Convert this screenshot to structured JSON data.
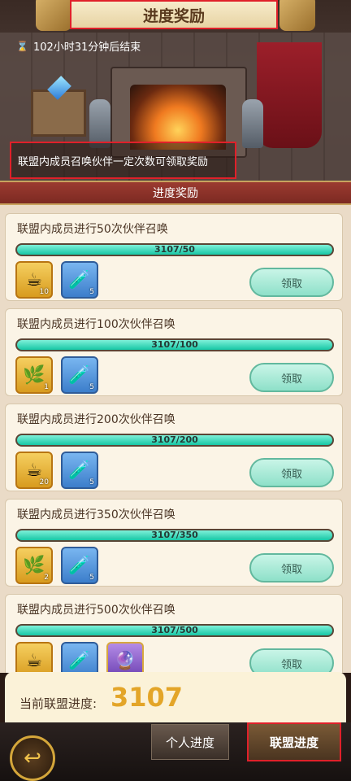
{
  "header": {
    "title": "进度奖励",
    "timer": "102小时31分钟后结束",
    "hint": "联盟内成员召唤伙伴一定次数可领取奖励"
  },
  "section": {
    "title": "进度奖励"
  },
  "tasks": [
    {
      "title": "联盟内成员进行50次伙伴召唤",
      "progress_text": "3107/50",
      "progress_fraction": 1.0,
      "rewards": [
        {
          "icon": "tea-cup-icon",
          "style": "gold",
          "count": "10"
        },
        {
          "icon": "potion-icon",
          "style": "blue",
          "count": "5"
        }
      ],
      "claim": "领取"
    },
    {
      "title": "联盟内成员进行100次伙伴召唤",
      "progress_text": "3107/100",
      "progress_fraction": 1.0,
      "rewards": [
        {
          "icon": "herb-bundle-icon",
          "style": "gold",
          "count": "1"
        },
        {
          "icon": "potion-icon",
          "style": "blue",
          "count": "5"
        }
      ],
      "claim": "领取"
    },
    {
      "title": "联盟内成员进行200次伙伴召唤",
      "progress_text": "3107/200",
      "progress_fraction": 1.0,
      "rewards": [
        {
          "icon": "tea-cup-icon",
          "style": "gold",
          "count": "20"
        },
        {
          "icon": "potion-icon",
          "style": "blue",
          "count": "5"
        }
      ],
      "claim": "领取"
    },
    {
      "title": "联盟内成员进行350次伙伴召唤",
      "progress_text": "3107/350",
      "progress_fraction": 1.0,
      "rewards": [
        {
          "icon": "herb-bundle-icon",
          "style": "gold",
          "count": "2"
        },
        {
          "icon": "potion-icon",
          "style": "blue",
          "count": "5"
        }
      ],
      "claim": "领取"
    },
    {
      "title": "联盟内成员进行500次伙伴召唤",
      "progress_text": "3107/500",
      "progress_fraction": 1.0,
      "rewards": [
        {
          "icon": "tea-cup-icon",
          "style": "gold",
          "count": ""
        },
        {
          "icon": "potion-icon",
          "style": "blue",
          "count": ""
        },
        {
          "icon": "crystal-card-icon",
          "style": "purple",
          "count": ""
        }
      ],
      "claim": "领取"
    }
  ],
  "current_progress": {
    "label": "当前联盟进度:",
    "value": "3107"
  },
  "bottom_tabs": {
    "personal": "个人进度",
    "alliance": "联盟进度"
  },
  "colors": {
    "accent_gold": "#e3a528",
    "progress_teal": "#17c7a6",
    "highlight_red": "#e0202a"
  }
}
